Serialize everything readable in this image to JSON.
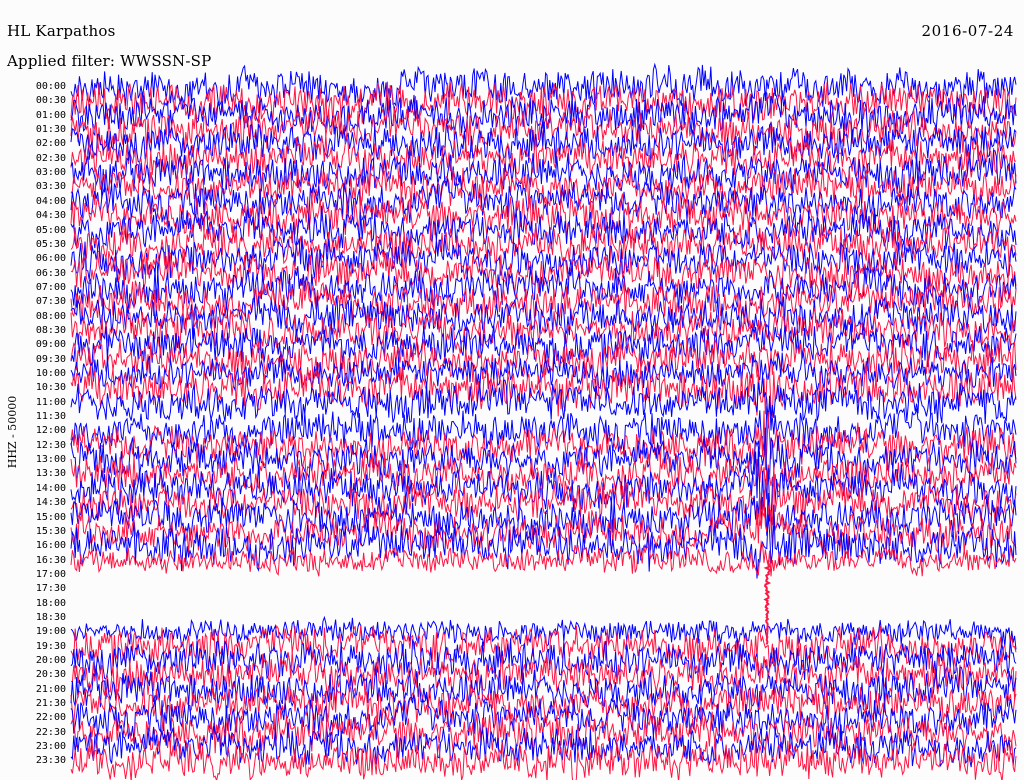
{
  "header": {
    "station": "HL Karpathos",
    "date": "2016-07-24",
    "filter": "Applied filter: WWSSN-SP"
  },
  "colors": {
    "background": "#fcfcfc",
    "trace_a": "#0000ff",
    "trace_b": "#ff1744"
  },
  "chart_data": {
    "type": "line",
    "title": "HL Karpathos",
    "subtitle": "Applied filter: WWSSN-SP",
    "ylabel": "HHZ - 50000",
    "xlabel": "",
    "grid": false,
    "legend": "none",
    "tick_labels": [
      "00:00",
      "00:30",
      "01:00",
      "01:30",
      "02:00",
      "02:30",
      "03:00",
      "03:30",
      "04:00",
      "04:30",
      "05:00",
      "05:30",
      "06:00",
      "06:30",
      "07:00",
      "07:30",
      "08:00",
      "08:30",
      "09:00",
      "09:30",
      "10:00",
      "10:30",
      "11:00",
      "11:30",
      "12:00",
      "12:30",
      "13:00",
      "13:30",
      "14:00",
      "14:30",
      "15:00",
      "15:30",
      "16:00",
      "16:30",
      "17:00",
      "17:30",
      "18:00",
      "18:30",
      "19:00",
      "19:30",
      "20:00",
      "20:30",
      "21:00",
      "21:30",
      "22:00",
      "22:30",
      "23:00",
      "23:30"
    ],
    "series_color_pattern": [
      "trace_a",
      "trace_b"
    ],
    "rows": [
      {
        "start": "00:00",
        "amplitude": 0.9,
        "gap": false
      },
      {
        "start": "00:30",
        "amplitude": 0.9,
        "gap": false
      },
      {
        "start": "01:00",
        "amplitude": 0.9,
        "gap": false
      },
      {
        "start": "01:30",
        "amplitude": 0.9,
        "gap": false
      },
      {
        "start": "02:00",
        "amplitude": 0.9,
        "gap": false
      },
      {
        "start": "02:30",
        "amplitude": 0.9,
        "gap": false
      },
      {
        "start": "03:00",
        "amplitude": 0.9,
        "gap": false
      },
      {
        "start": "03:30",
        "amplitude": 0.9,
        "gap": false
      },
      {
        "start": "04:00",
        "amplitude": 0.9,
        "gap": false
      },
      {
        "start": "04:30",
        "amplitude": 0.9,
        "gap": false
      },
      {
        "start": "05:00",
        "amplitude": 0.9,
        "gap": false
      },
      {
        "start": "05:30",
        "amplitude": 0.9,
        "gap": false
      },
      {
        "start": "06:00",
        "amplitude": 0.9,
        "gap": false
      },
      {
        "start": "06:30",
        "amplitude": 0.9,
        "gap": false
      },
      {
        "start": "07:00",
        "amplitude": 0.9,
        "gap": false
      },
      {
        "start": "07:30",
        "amplitude": 0.9,
        "gap": false
      },
      {
        "start": "08:00",
        "amplitude": 0.9,
        "gap": false
      },
      {
        "start": "08:30",
        "amplitude": 0.9,
        "gap": false
      },
      {
        "start": "09:00",
        "amplitude": 0.9,
        "gap": false
      },
      {
        "start": "09:30",
        "amplitude": 0.9,
        "gap": false
      },
      {
        "start": "10:00",
        "amplitude": 0.8,
        "gap": false
      },
      {
        "start": "10:30",
        "amplitude": 1.0,
        "gap": false
      },
      {
        "start": "11:00",
        "amplitude": 0.9,
        "gap": false
      },
      {
        "start": "11:30",
        "amplitude": 0.0,
        "gap": true
      },
      {
        "start": "12:00",
        "amplitude": 0.9,
        "gap": false
      },
      {
        "start": "12:30",
        "amplitude": 0.9,
        "gap": false
      },
      {
        "start": "13:00",
        "amplitude": 0.9,
        "gap": false
      },
      {
        "start": "13:30",
        "amplitude": 0.9,
        "gap": false
      },
      {
        "start": "14:00",
        "amplitude": 0.9,
        "gap": false
      },
      {
        "start": "14:30",
        "amplitude": 0.9,
        "gap": false
      },
      {
        "start": "15:00",
        "amplitude": 0.9,
        "gap": false
      },
      {
        "start": "15:30",
        "amplitude": 0.9,
        "gap": false
      },
      {
        "start": "16:00",
        "amplitude": 1.0,
        "gap": false
      },
      {
        "start": "16:30",
        "amplitude": 0.6,
        "gap": false
      },
      {
        "start": "17:00",
        "amplitude": 0.0,
        "gap": true
      },
      {
        "start": "17:30",
        "amplitude": 0.0,
        "gap": true
      },
      {
        "start": "18:00",
        "amplitude": 0.0,
        "gap": true
      },
      {
        "start": "18:30",
        "amplitude": 0.0,
        "gap": true
      },
      {
        "start": "19:00",
        "amplitude": 0.6,
        "gap": false
      },
      {
        "start": "19:30",
        "amplitude": 0.9,
        "gap": false
      },
      {
        "start": "20:00",
        "amplitude": 0.9,
        "gap": false
      },
      {
        "start": "20:30",
        "amplitude": 0.9,
        "gap": false
      },
      {
        "start": "21:00",
        "amplitude": 0.9,
        "gap": false
      },
      {
        "start": "21:30",
        "amplitude": 0.9,
        "gap": false
      },
      {
        "start": "22:00",
        "amplitude": 0.9,
        "gap": false
      },
      {
        "start": "22:30",
        "amplitude": 0.9,
        "gap": false
      },
      {
        "start": "23:00",
        "amplitude": 0.9,
        "gap": false
      },
      {
        "start": "23:30",
        "amplitude": 0.9,
        "gap": false
      }
    ]
  }
}
